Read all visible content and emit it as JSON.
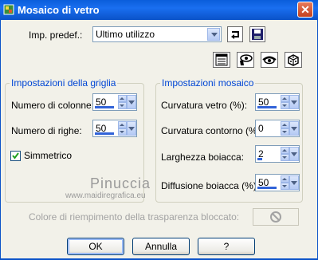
{
  "window": {
    "title": "Mosaico di vetro"
  },
  "preset": {
    "label": "Imp. predef.:",
    "value": "Ultimo utilizzo"
  },
  "grid_group": {
    "title": "Impostazioni della griglia",
    "columns_label": "Numero di colonne:",
    "columns_value": "50",
    "rows_label": "Numero di righe:",
    "rows_value": "50",
    "symmetric_label": "Simmetrico",
    "symmetric_checked": true
  },
  "mosaic_group": {
    "title": "Impostazioni mosaico",
    "glass_curvature_label": "Curvatura vetro (%):",
    "glass_curvature_value": "50",
    "edge_curvature_label": "Curvatura contorno (%):",
    "edge_curvature_value": "0",
    "grout_width_label": "Larghezza boiacca:",
    "grout_width_value": "2",
    "grout_diffusion_label": "Diffusione boiacca (%):",
    "grout_diffusion_value": "50"
  },
  "watermark": {
    "name": "Pinuccia",
    "site": "www.maidiregrafica.eu"
  },
  "transparency": {
    "label": "Colore di riempimento della trasparenza bloccato:"
  },
  "buttons": {
    "ok": "OK",
    "cancel": "Annulla",
    "help": "?"
  },
  "colors": {
    "titlebar": "#0a5ddb",
    "accent": "#0046d5",
    "face": "#f2f1e9"
  }
}
